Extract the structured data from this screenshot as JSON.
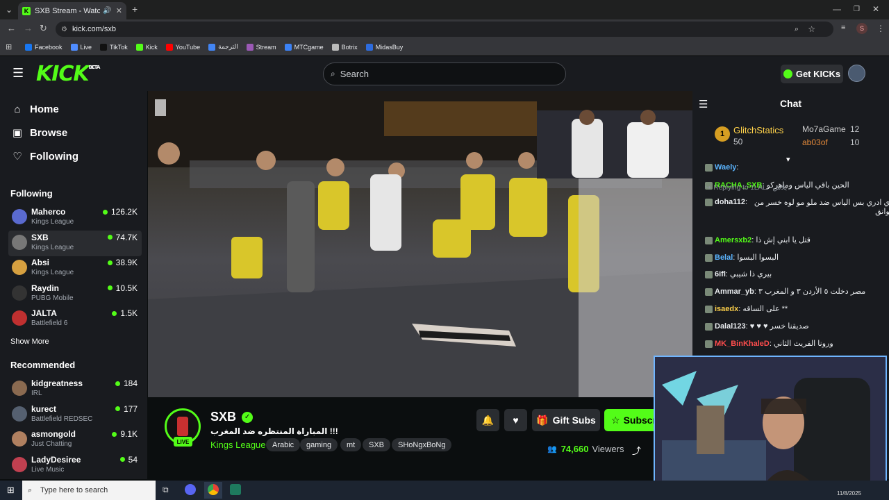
{
  "browser": {
    "tab_title": "SXB Stream - Watch Live on",
    "url": "kick.com/sxb",
    "profile_initial": "S",
    "bookmarks": [
      {
        "label": "Facebook",
        "icon": "facebook-icon",
        "color": "#1877f2"
      },
      {
        "label": "Live",
        "icon": "live-icon",
        "color": "#4f8cff"
      },
      {
        "label": "TikTok",
        "icon": "tiktok-icon",
        "color": "#111111"
      },
      {
        "label": "Kick",
        "icon": "kick-icon",
        "color": "#53fc18"
      },
      {
        "label": "YouTube",
        "icon": "youtube-icon",
        "color": "#ff0000"
      },
      {
        "label": "الترجمة",
        "icon": "translate-icon",
        "color": "#4285f4"
      },
      {
        "label": "Stream",
        "icon": "stream-icon",
        "color": "#9b59b6"
      },
      {
        "label": "MTCgame",
        "icon": "mtcgame-icon",
        "color": "#3b82f6"
      },
      {
        "label": "Botrix",
        "icon": "botrix-icon",
        "color": "#bbbbbb"
      },
      {
        "label": "MidasBuy",
        "icon": "midasbuy-icon",
        "color": "#2d6cdf"
      }
    ]
  },
  "header": {
    "logo": "KICK",
    "logo_badge": "BETA",
    "search_placeholder": "Search",
    "get_kicks_label": "Get KICKs"
  },
  "sidebar": {
    "nav": [
      {
        "label": "Home",
        "icon": "home-icon"
      },
      {
        "label": "Browse",
        "icon": "browse-icon"
      },
      {
        "label": "Following",
        "icon": "heart-icon"
      }
    ],
    "following_title": "Following",
    "following": [
      {
        "name": "Maherco",
        "category": "Kings League",
        "viewers": "126.2K",
        "color": "#5a6acf"
      },
      {
        "name": "SXB",
        "category": "Kings League",
        "viewers": "74.7K",
        "color": "#777777"
      },
      {
        "name": "Absi",
        "category": "Kings League",
        "viewers": "38.9K",
        "color": "#d6a040"
      },
      {
        "name": "Raydin",
        "category": "PUBG Mobile",
        "viewers": "10.5K",
        "color": "#333333"
      },
      {
        "name": "JALTA",
        "category": "Battlefield 6",
        "viewers": "1.5K",
        "color": "#c03030"
      }
    ],
    "show_more": "Show More",
    "recommended_title": "Recommended",
    "recommended": [
      {
        "name": "kidgreatness",
        "category": "IRL",
        "viewers": "184",
        "color": "#8a6a50"
      },
      {
        "name": "kurect",
        "category": "Battlefield REDSEC",
        "viewers": "177",
        "color": "#556070"
      },
      {
        "name": "asmongold",
        "category": "Just Chatting",
        "viewers": "9.1K",
        "color": "#b08060"
      },
      {
        "name": "LadyDesiree",
        "category": "Live Music",
        "viewers": "54",
        "color": "#c04050"
      }
    ]
  },
  "stream": {
    "channel": "SXB",
    "title": "المباراة المنتظره ضد المغرب !!!",
    "category": "Kings League",
    "live_label": "LIVE",
    "tags": [
      "Arabic",
      "gaming",
      "mt",
      "SXB",
      "SHoNgxBoNg"
    ],
    "viewers": "74,660",
    "viewers_label": "Viewers",
    "gift_subs_label": "Gift Subs",
    "subscribe_label": "Subscr"
  },
  "chat": {
    "title": "Chat",
    "leaderboard": [
      {
        "rank": "1",
        "name": "GlitchStatics",
        "value": "50"
      },
      {
        "rank": "",
        "name": "Mo7aGame",
        "value": "12"
      },
      {
        "rank": "",
        "name": "ab03of",
        "value": "10"
      }
    ],
    "messages": [
      {
        "user": "Waely",
        "text": "",
        "color": "#5bb5ff"
      },
      {
        "user": "RACHA_SXB",
        "text": "الحين باقي الياس وماهركو",
        "color": "#53fc18"
      },
      {
        "user": "doha112",
        "text": "أي ادري بس الياس ضد ملو مو لوه خسر من ثوانق",
        "color": "#e9ecef",
        "reply": "Replying to 1LAL:",
        "reply_extra": "بلاش"
      },
      {
        "user": "Amersxb2",
        "text": "قتل يا ابني إش ذا",
        "color": "#53fc18"
      },
      {
        "user": "Belal",
        "text": "البسوا البسوا",
        "color": "#5bb5ff"
      },
      {
        "user": "6ifl",
        "text": "بيري ذا شيبي",
        "color": "#e9ecef"
      },
      {
        "user": "Ammar_yb",
        "text": "مصر دخلت ٥ الأردن ٣ و المغرب ٣",
        "color": "#e9ecef"
      },
      {
        "user": "isaedx",
        "text": "** على الساقه",
        "color": "#ffd24a"
      },
      {
        "user": "Dalal123",
        "text": "صديقنا خسر ♥ ♥ ♥",
        "color": "#e9ecef"
      },
      {
        "user": "MK_BinKhaleD",
        "text": "ورونا الفريث الثاني",
        "color": "#ff4d4d"
      }
    ]
  },
  "taskbar": {
    "search_placeholder": "Type here to search",
    "date": "11/8/2025"
  }
}
